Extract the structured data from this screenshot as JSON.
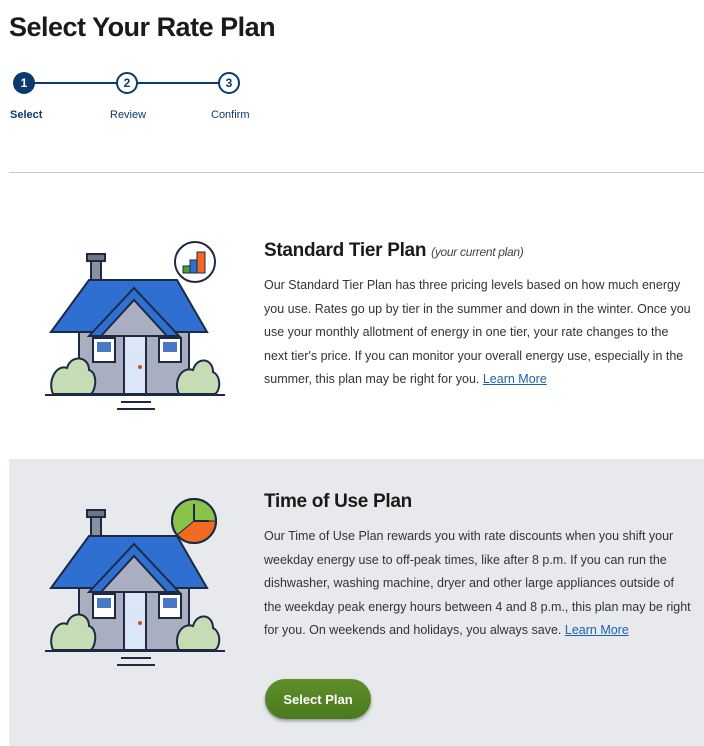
{
  "page": {
    "title": "Select Your Rate Plan"
  },
  "stepper": {
    "steps": [
      {
        "number": "1",
        "label": "Select"
      },
      {
        "number": "2",
        "label": "Review"
      },
      {
        "number": "3",
        "label": "Confirm"
      }
    ],
    "active_step": 1
  },
  "plans": [
    {
      "title": "Standard Tier Plan",
      "subtitle": "(your current plan)",
      "description": "Our Standard Tier Plan has three pricing levels based on how much energy you use. Rates go up by tier in the summer and down in the winter. Once you use your monthly allotment of energy in one tier, your rate changes to the next tier's price. If you can monitor your overall energy use, especially in the summer, this plan may be right for you.",
      "link": "Learn More",
      "badge_icon": "bar-chart-icon"
    },
    {
      "title": "Time of Use Plan",
      "description": "Our Time of Use Plan rewards you with rate discounts when you shift your weekday energy use to off-peak times, like after 8 p.m. If you can run the dishwasher, washing machine, dryer and other large appliances outside of the weekday peak energy hours between 4 and 8 p.m., this plan may be right for you. On weekends and holidays, you always save.",
      "link": "Learn More",
      "button": "Select Plan",
      "badge_icon": "clock-icon"
    }
  ],
  "colors": {
    "navy": "#0b3a6e",
    "roof": "#2f6fd1",
    "wall": "#a9afc0",
    "green_button": "#4f7f21",
    "link": "#1a63a8",
    "band": "#e8e9ec"
  }
}
